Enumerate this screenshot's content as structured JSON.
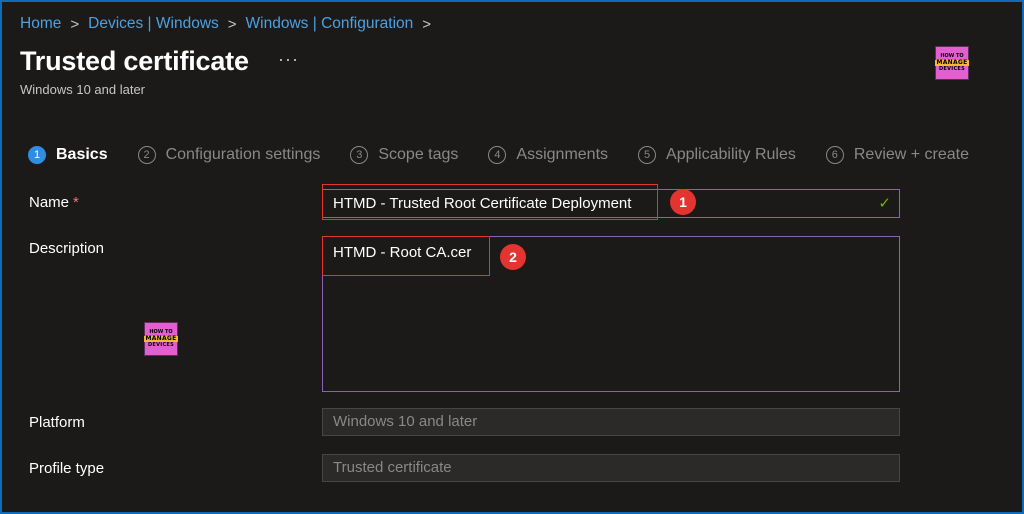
{
  "breadcrumb": [
    "Home",
    "Devices | Windows",
    "Windows | Configuration"
  ],
  "breadcrumb_separator": ">",
  "header": {
    "title": "Trusted certificate",
    "more_label": "···",
    "subtitle": "Windows 10 and later"
  },
  "logo": {
    "line1": "HOW TO",
    "line2": "MANAGE",
    "line3": "DEVICES"
  },
  "tabs": [
    {
      "num": "1",
      "label": "Basics",
      "active": true
    },
    {
      "num": "2",
      "label": "Configuration settings"
    },
    {
      "num": "3",
      "label": "Scope tags"
    },
    {
      "num": "4",
      "label": "Assignments"
    },
    {
      "num": "5",
      "label": "Applicability Rules"
    },
    {
      "num": "6",
      "label": "Review + create"
    }
  ],
  "form": {
    "name_label": "Name",
    "required_mark": "*",
    "name_value": "HTMD - Trusted Root Certificate Deployment",
    "check_glyph": "✓",
    "description_label": "Description",
    "description_value": "HTMD - Root CA.cer",
    "platform_label": "Platform",
    "platform_value": "Windows 10 and later",
    "profile_type_label": "Profile type",
    "profile_type_value": "Trusted certificate"
  },
  "annotations": {
    "badge1": "1",
    "badge2": "2"
  },
  "colors": {
    "accent": "#2f8de4",
    "link": "#4ca0e0",
    "focus_border": "#8764b8",
    "annotation_red": "#e3342f",
    "success": "#6bb700"
  }
}
